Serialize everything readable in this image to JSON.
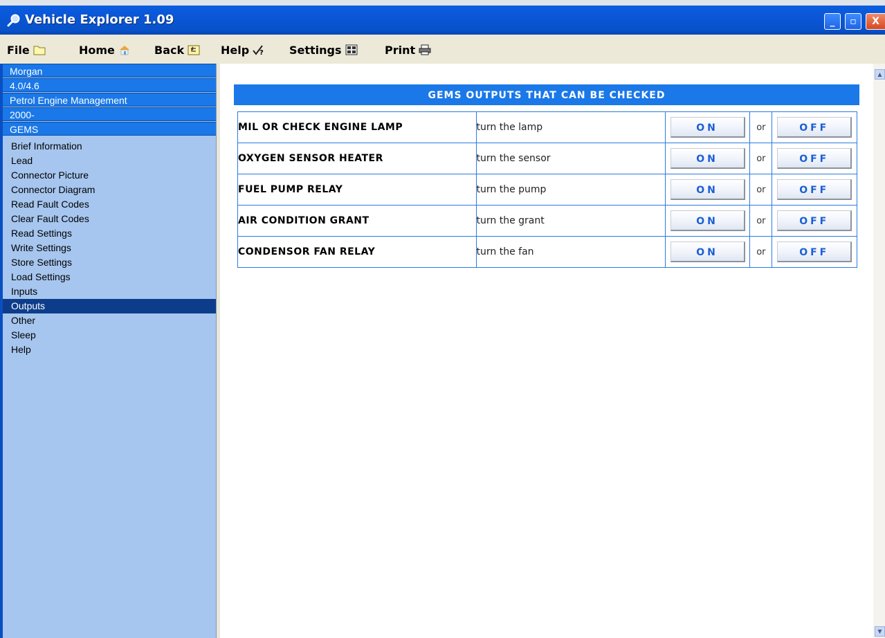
{
  "window": {
    "title": "Vehicle Explorer 1.09",
    "controls": {
      "minimize": "_",
      "maximize": "▫",
      "close": "X"
    }
  },
  "menu": [
    {
      "label": "File",
      "icon": "folder-icon"
    },
    {
      "label": "Home",
      "icon": "home-icon"
    },
    {
      "label": "Back",
      "icon": "back-icon"
    },
    {
      "label": "Help",
      "icon": "help-icon"
    },
    {
      "label": "Settings",
      "icon": "settings-icon"
    },
    {
      "label": "Print",
      "icon": "printer-icon"
    }
  ],
  "breadcrumbs": [
    "Morgan",
    "4.0/4.6",
    "Petrol Engine Management",
    "2000-",
    "GEMS"
  ],
  "nav": [
    "Brief Information",
    "Lead",
    "Connector Picture",
    "Connector Diagram",
    "Read Fault Codes",
    "Clear Fault Codes",
    "Read Settings",
    "Write Settings",
    "Store Settings",
    "Load Settings",
    "Inputs",
    "Outputs",
    "Other",
    "Sleep",
    "Help"
  ],
  "nav_active": "Outputs",
  "panel": {
    "header": "GEMS OUTPUTS THAT CAN BE CHECKED",
    "or_label": "or",
    "on_label": "ON",
    "off_label": "OFF",
    "rows": [
      {
        "name": "MIL OR CHECK ENGINE LAMP",
        "action": "turn the lamp"
      },
      {
        "name": "OXYGEN SENSOR HEATER",
        "action": "turn the sensor"
      },
      {
        "name": "FUEL PUMP RELAY",
        "action": "turn the pump"
      },
      {
        "name": "AIR CONDITION GRANT",
        "action": "turn the grant"
      },
      {
        "name": "CONDENSOR FAN RELAY",
        "action": "turn the fan"
      }
    ]
  },
  "colors": {
    "titlebar": "#0a56d6",
    "crumb": "#1a78e8",
    "sidebar": "#a6c6ef",
    "active_nav": "#0d3d8a",
    "button_text": "#1a5fd6"
  }
}
